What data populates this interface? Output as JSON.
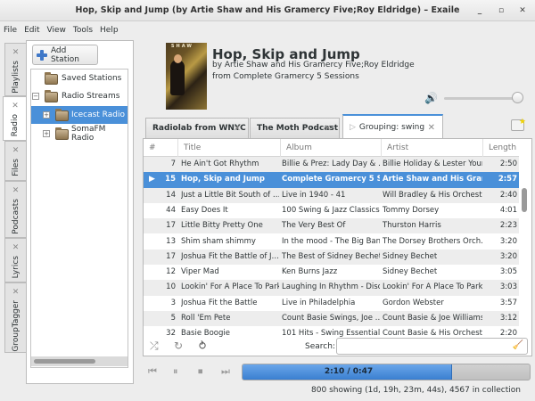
{
  "window": {
    "title": "Hop, Skip and Jump (by Artie Shaw and His Gramercy Five;Roy Eldridge) – Exaile",
    "minimize": "_",
    "maximize": "▫",
    "close": "✕"
  },
  "menu": [
    "File",
    "Edit",
    "View",
    "Tools",
    "Help"
  ],
  "side_tabs": [
    {
      "label": "Playlists"
    },
    {
      "label": "Radio",
      "active": true
    },
    {
      "label": "Files"
    },
    {
      "label": "Podcasts"
    },
    {
      "label": "Lyrics"
    },
    {
      "label": "GroupTagger"
    }
  ],
  "radio": {
    "add_station": "Add Station",
    "tree": [
      {
        "label": "Saved Stations",
        "expander": ""
      },
      {
        "label": "Radio Streams",
        "expander": "−"
      },
      {
        "label": "Icecast Radio",
        "expander": "+",
        "selected": true
      },
      {
        "label": "SomaFM Radio",
        "expander": "+"
      }
    ]
  },
  "now_playing": {
    "title": "Hop, Skip and Jump",
    "by": "by Artie Shaw and His Gramercy Five;Roy Eldridge",
    "from": "from Complete Gramercy 5 Sessions",
    "album_art_text": "ARTIE SHAW",
    "volume": 0.95
  },
  "playlist_tabs": [
    {
      "label": "Radiolab from WNYC"
    },
    {
      "label": "The Moth Podcast"
    },
    {
      "label": "Grouping: swing",
      "active": true
    }
  ],
  "table": {
    "columns": [
      "#",
      "Title",
      "Album",
      "Artist",
      "Length"
    ],
    "rows": [
      [
        "7",
        "He Ain't Got Rhythm",
        "Billie & Prez: Lady Day & …",
        "Billie Holiday & Lester Young",
        "2:50"
      ],
      [
        "15",
        "Hop, Skip and Jump",
        "Complete Gramercy 5 Ses…",
        "Artie Shaw and His Gram…",
        "2:57"
      ],
      [
        "14",
        "Just a Little Bit South of …",
        "Live in 1940 - 41",
        "Will Bradley & His Orchestra",
        "2:40"
      ],
      [
        "44",
        "Easy Does It",
        "100 Swing & Jazz Classics",
        "Tommy Dorsey",
        "4:01"
      ],
      [
        "17",
        "Little Bitty Pretty One",
        "The Very Best Of",
        "Thurston Harris",
        "2:23"
      ],
      [
        "13",
        "Shim sham shimmy",
        "In the mood - The Big Ban…",
        "The Dorsey Brothers Orch…",
        "3:20"
      ],
      [
        "17",
        "Joshua Fit the Battle of J…",
        "The Best of Sidney Bechet…",
        "Sidney Bechet",
        "3:20"
      ],
      [
        "12",
        "Viper Mad",
        "Ken Burns Jazz",
        "Sidney Bechet",
        "3:05"
      ],
      [
        "10",
        "Lookin' For A Place To Park",
        "Laughing In Rhythm - Disc…",
        "Lookin' For A Place To Park",
        "3:03"
      ],
      [
        "3",
        "Joshua Fit the Battle",
        "Live in Philadelphia",
        "Gordon Webster",
        "3:57"
      ],
      [
        "5",
        "Roll 'Em Pete",
        "Count Basie Swings, Joe …",
        "Count Basie & Joe Williams",
        "3:12"
      ],
      [
        "32",
        "Basie Boogie",
        "101 Hits - Swing Essentials",
        "Count Basie & His Orchestra",
        "2:20"
      ]
    ],
    "playing_row": 1
  },
  "search": {
    "label": "Search:",
    "value": ""
  },
  "progress": {
    "text": "2:10 / 0:47",
    "fraction": 0.73
  },
  "status": "800 showing (1d, 19h, 23m, 44s), 4567 in collection",
  "colors": {
    "accent": "#4a90d9"
  }
}
